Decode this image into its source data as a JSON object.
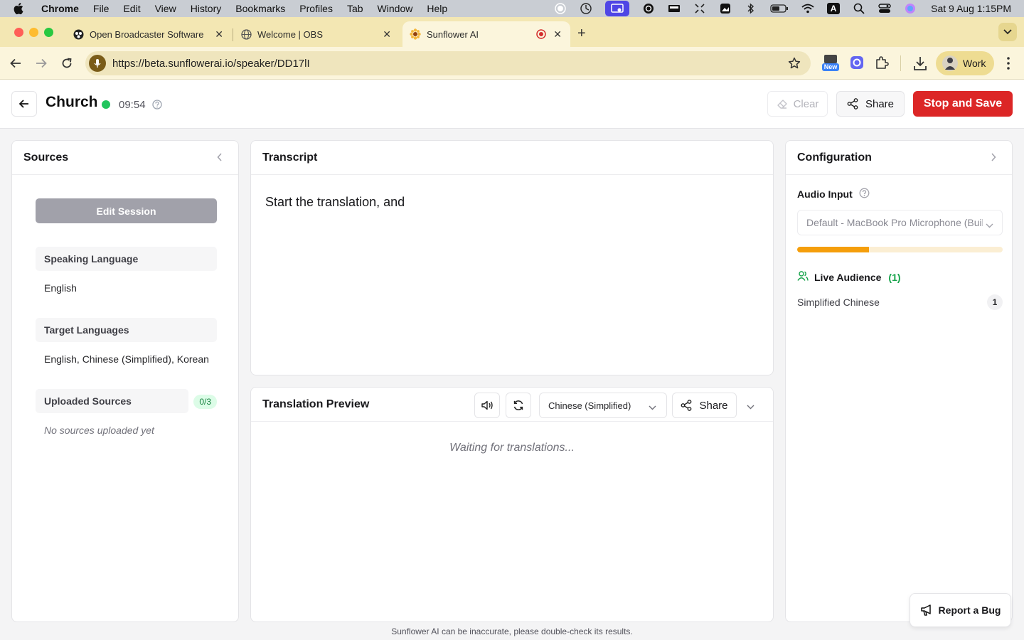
{
  "menubar": {
    "app": "Chrome",
    "items": [
      "File",
      "Edit",
      "View",
      "History",
      "Bookmarks",
      "Profiles",
      "Tab",
      "Window",
      "Help"
    ],
    "clock": "Sat 9 Aug  1:15PM",
    "icons": [
      "record-icon",
      "timer-icon",
      "screen-share-icon",
      "chat-icon",
      "battery-app-icon",
      "dots-icon",
      "photo-icon",
      "bluetooth-icon",
      "battery-icon",
      "wifi-icon",
      "keyboard-icon",
      "search-icon",
      "control-center-icon",
      "siri-icon"
    ],
    "keyboard_label": "A"
  },
  "tabs": [
    {
      "title": "Open Broadcaster Software |",
      "icon": "obs-icon"
    },
    {
      "title": "Welcome | OBS",
      "icon": "globe-icon"
    },
    {
      "title": "Sunflower AI",
      "icon": "sunflower-icon",
      "active": true
    }
  ],
  "toolbar": {
    "url": "https://beta.sunflowerai.io/speaker/DD17lI",
    "profile": "Work",
    "ext_badge": "New"
  },
  "header": {
    "title": "Church",
    "timer": "09:54",
    "status_color": "#22c55e",
    "clear_label": "Clear",
    "share_label": "Share",
    "stop_label": "Stop and Save"
  },
  "sources": {
    "title": "Sources",
    "edit_label": "Edit Session",
    "speaking_label": "Speaking Language",
    "speaking_value": "English",
    "target_label": "Target Languages",
    "target_value": "English, Chinese (Simplified), Korean",
    "uploaded_label": "Uploaded Sources",
    "uploaded_count": "0/3",
    "empty_text": "No sources uploaded yet"
  },
  "transcript": {
    "title": "Transcript",
    "text": "Start the translation, and"
  },
  "preview": {
    "title": "Translation Preview",
    "language": "Chinese (Simplified)",
    "share_label": "Share",
    "waiting_text": "Waiting for translations..."
  },
  "config": {
    "title": "Configuration",
    "audio_label": "Audio Input",
    "audio_device": "Default - MacBook Pro Microphone (Built-in)",
    "audio_level": 0.35,
    "audience_label": "Live Audience",
    "audience_count": "(1)",
    "audience": [
      {
        "language": "Simplified Chinese",
        "count": "1"
      }
    ]
  },
  "report_bug_label": "Report a Bug",
  "footer_note": "Sunflower AI can be inaccurate, please double-check its results.",
  "colors": {
    "accent_red": "#dc2626",
    "live_green": "#22c55e",
    "level_fill": "#f59e0b",
    "tab_strip": "#f3e7b3"
  }
}
